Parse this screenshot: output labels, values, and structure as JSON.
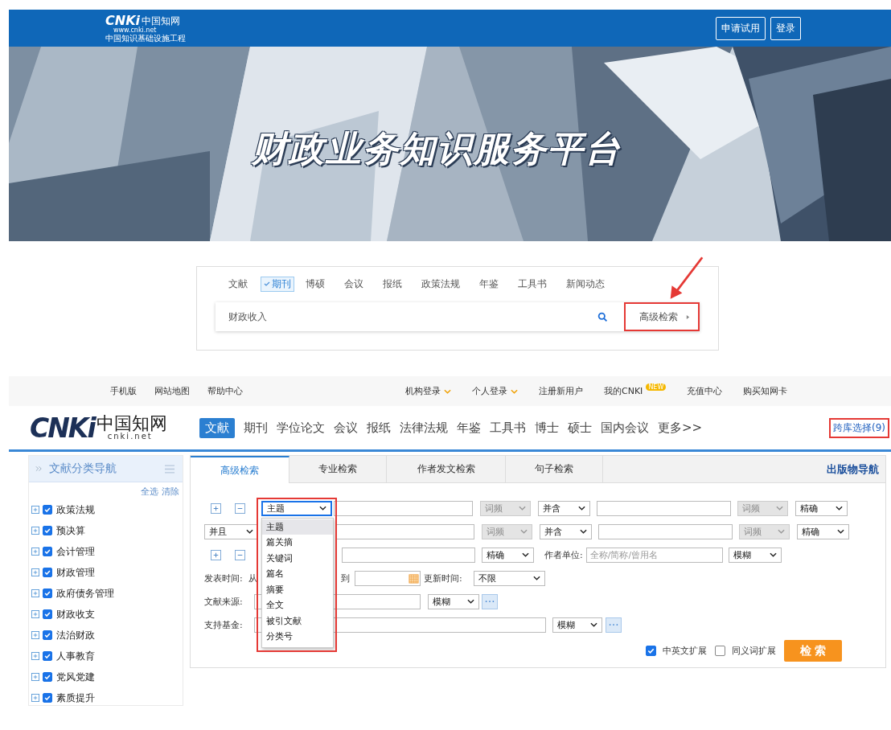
{
  "header": {
    "logo": {
      "mark": "CNKi",
      "name": "中国知网",
      "url": "www.cnki.net",
      "tagline": "中国知识基础设施工程"
    },
    "buttons": [
      "申请试用",
      "登录"
    ]
  },
  "banner": {
    "kind": "picture",
    "title": "财政业务知识服务平台"
  },
  "quick_search": {
    "tabs": [
      {
        "label": "文献",
        "selected": false
      },
      {
        "label": "期刊",
        "selected": true
      },
      {
        "label": "博硕",
        "selected": false
      },
      {
        "label": "会议",
        "selected": false
      },
      {
        "label": "报纸",
        "selected": false
      },
      {
        "label": "政策法规",
        "selected": false
      },
      {
        "label": "年鉴",
        "selected": false
      },
      {
        "label": "工具书",
        "selected": false
      },
      {
        "label": "新闻动态",
        "selected": false
      }
    ],
    "query": "财政收入",
    "advanced": "高级检索"
  },
  "top_links": {
    "left": [
      "手机版",
      "网站地图",
      "帮助中心"
    ],
    "right": [
      {
        "label": "机构登录",
        "menu": true
      },
      {
        "label": "个人登录",
        "menu": true
      },
      {
        "label": "注册新用户",
        "menu": false
      },
      {
        "label": "我的CNKI",
        "menu": false,
        "badge": "NEW"
      },
      {
        "label": "充值中心",
        "menu": false
      },
      {
        "label": "购买知网卡",
        "menu": false
      }
    ]
  },
  "nav": {
    "logo": {
      "mark": "CNKi",
      "name": "中国知网",
      "url": "cnki.net"
    },
    "items": [
      {
        "label": "文献",
        "selected": true
      },
      {
        "label": "期刊",
        "selected": false
      },
      {
        "label": "学位论文",
        "selected": false
      },
      {
        "label": "会议",
        "selected": false
      },
      {
        "label": "报纸",
        "selected": false
      },
      {
        "label": "法律法规",
        "selected": false
      },
      {
        "label": "年鉴",
        "selected": false
      },
      {
        "label": "工具书",
        "selected": false
      },
      {
        "label": "博士",
        "selected": false
      },
      {
        "label": "硕士",
        "selected": false
      },
      {
        "label": "国内会议",
        "selected": false
      },
      {
        "label": "更多>>",
        "selected": false
      }
    ],
    "cross_db": "跨库选择(9)"
  },
  "sidebar": {
    "title": "文献分类导航",
    "select_all": "全选",
    "clear": "清除",
    "categories": [
      {
        "label": "政策法规",
        "checked": true
      },
      {
        "label": "预决算",
        "checked": true
      },
      {
        "label": "会计管理",
        "checked": true
      },
      {
        "label": "财政管理",
        "checked": true
      },
      {
        "label": "政府债务管理",
        "checked": true
      },
      {
        "label": "财政收支",
        "checked": true
      },
      {
        "label": "法治财政",
        "checked": true
      },
      {
        "label": "人事教育",
        "checked": true
      },
      {
        "label": "党风党建",
        "checked": true
      },
      {
        "label": "素质提升",
        "checked": true
      }
    ]
  },
  "search_panel": {
    "tabs": [
      {
        "label": "高级检索",
        "selected": true
      },
      {
        "label": "专业检索",
        "selected": false
      },
      {
        "label": "作者发文检索",
        "selected": false
      },
      {
        "label": "句子检索",
        "selected": false
      }
    ],
    "publication_nav": "出版物导航",
    "rows": [
      [
        {
          "kind": "plus"
        },
        {
          "kind": "minus"
        },
        {
          "kind": "select",
          "value": "主题",
          "disabled": false,
          "open": true
        },
        {
          "kind": "input"
        },
        {
          "kind": "select",
          "value": "词频",
          "disabled": true
        },
        {
          "kind": "select",
          "value": "并含",
          "disabled": false
        },
        {
          "kind": "input"
        },
        {
          "kind": "select",
          "value": "词频",
          "disabled": true
        },
        {
          "kind": "select",
          "value": "精确",
          "disabled": false
        }
      ],
      [
        {
          "kind": "select",
          "value": "并且",
          "disabled": false
        },
        "",
        "",
        {
          "kind": "input"
        },
        {
          "kind": "select",
          "value": "词频",
          "disabled": true
        },
        {
          "kind": "select",
          "value": "并含",
          "disabled": false
        },
        {
          "kind": "input"
        },
        {
          "kind": "select",
          "value": "词频",
          "disabled": true
        },
        {
          "kind": "select",
          "value": "精确",
          "disabled": false
        }
      ],
      [
        {
          "kind": "plus"
        },
        {
          "kind": "minus"
        },
        "",
        {
          "kind": "input"
        },
        {
          "kind": "select",
          "value": "精确",
          "disabled": false
        },
        {
          "kind": "label",
          "text": "作者单位:"
        },
        {
          "kind": "input",
          "placeholder": "全称/简称/曾用名"
        },
        {
          "kind": "select",
          "value": "模糊",
          "disabled": false
        }
      ],
      [
        {
          "kind": "label",
          "text": "发表时间:"
        },
        {
          "kind": "label",
          "text": "从"
        },
        "",
        {
          "kind": "label",
          "text": "到"
        },
        {
          "kind": "date"
        },
        {
          "kind": "label",
          "text": "更新时间:"
        },
        {
          "kind": "select",
          "value": "不限",
          "disabled": false
        }
      ],
      [
        {
          "kind": "label",
          "text": "文献来源:"
        },
        {
          "kind": "input"
        },
        {
          "kind": "select",
          "value": "模糊",
          "disabled": false
        },
        {
          "kind": "more"
        }
      ],
      [
        {
          "kind": "label",
          "text": "支持基金:"
        },
        {
          "kind": "input"
        },
        {
          "kind": "select",
          "value": "模糊",
          "disabled": false
        },
        {
          "kind": "more"
        }
      ]
    ],
    "dropdown": [
      {
        "label": "主题",
        "selected": true
      },
      {
        "label": "篇关摘",
        "selected": false
      },
      {
        "label": "关键词",
        "selected": false
      },
      {
        "label": "篇名",
        "selected": false
      },
      {
        "label": "摘要",
        "selected": false
      },
      {
        "label": "全文",
        "selected": false
      },
      {
        "label": "被引文献",
        "selected": false
      },
      {
        "label": "分类号",
        "selected": false
      }
    ],
    "options": [
      {
        "label": "中英文扩展",
        "checked": true
      },
      {
        "label": "同义词扩展",
        "checked": false
      }
    ],
    "submit": "检 索"
  }
}
